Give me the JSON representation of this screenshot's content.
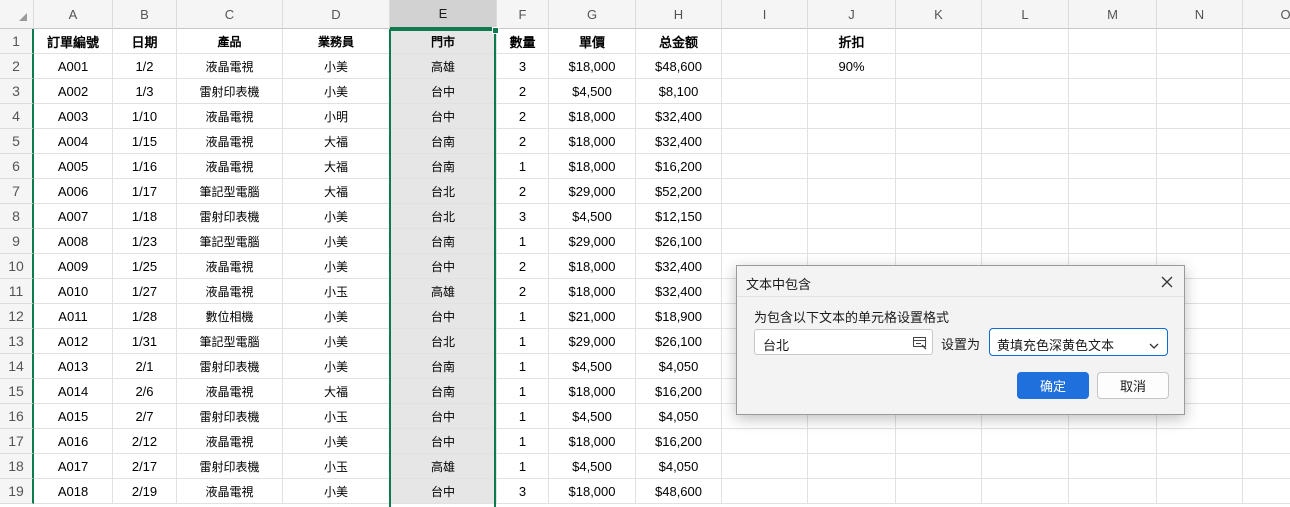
{
  "columns": [
    "A",
    "B",
    "C",
    "D",
    "E",
    "F",
    "G",
    "H",
    "I",
    "J",
    "K",
    "L",
    "M",
    "N",
    "O"
  ],
  "selected_column": "E",
  "row_numbers": [
    "1",
    "2",
    "3",
    "4",
    "5",
    "6",
    "7",
    "8",
    "9",
    "10",
    "11",
    "12",
    "13",
    "14",
    "15",
    "16",
    "17",
    "18",
    "19"
  ],
  "rows": [
    [
      "訂單編號",
      "日期",
      "產品",
      "業務員",
      "門市",
      "數量",
      "單價",
      "总金额",
      "",
      "折扣",
      "",
      "",
      "",
      "",
      ""
    ],
    [
      "A001",
      "1/2",
      "液晶電視",
      "小美",
      "高雄",
      "3",
      "$18,000",
      "$48,600",
      "",
      "90%",
      "",
      "",
      "",
      "",
      ""
    ],
    [
      "A002",
      "1/3",
      "雷射印表機",
      "小美",
      "台中",
      "2",
      "$4,500",
      "$8,100",
      "",
      "",
      "",
      "",
      "",
      "",
      ""
    ],
    [
      "A003",
      "1/10",
      "液晶電視",
      "小明",
      "台中",
      "2",
      "$18,000",
      "$32,400",
      "",
      "",
      "",
      "",
      "",
      "",
      ""
    ],
    [
      "A004",
      "1/15",
      "液晶電視",
      "大福",
      "台南",
      "2",
      "$18,000",
      "$32,400",
      "",
      "",
      "",
      "",
      "",
      "",
      ""
    ],
    [
      "A005",
      "1/16",
      "液晶電視",
      "大福",
      "台南",
      "1",
      "$18,000",
      "$16,200",
      "",
      "",
      "",
      "",
      "",
      "",
      ""
    ],
    [
      "A006",
      "1/17",
      "筆記型電腦",
      "大福",
      "台北",
      "2",
      "$29,000",
      "$52,200",
      "",
      "",
      "",
      "",
      "",
      "",
      ""
    ],
    [
      "A007",
      "1/18",
      "雷射印表機",
      "小美",
      "台北",
      "3",
      "$4,500",
      "$12,150",
      "",
      "",
      "",
      "",
      "",
      "",
      ""
    ],
    [
      "A008",
      "1/23",
      "筆記型電腦",
      "小美",
      "台南",
      "1",
      "$29,000",
      "$26,100",
      "",
      "",
      "",
      "",
      "",
      "",
      ""
    ],
    [
      "A009",
      "1/25",
      "液晶電視",
      "小美",
      "台中",
      "2",
      "$18,000",
      "$32,400",
      "",
      "",
      "",
      "",
      "",
      "",
      ""
    ],
    [
      "A010",
      "1/27",
      "液晶電視",
      "小玉",
      "高雄",
      "2",
      "$18,000",
      "$32,400",
      "",
      "",
      "",
      "",
      "",
      "",
      ""
    ],
    [
      "A011",
      "1/28",
      "數位相機",
      "小美",
      "台中",
      "1",
      "$21,000",
      "$18,900",
      "",
      "",
      "",
      "",
      "",
      "",
      ""
    ],
    [
      "A012",
      "1/31",
      "筆記型電腦",
      "小美",
      "台北",
      "1",
      "$29,000",
      "$26,100",
      "",
      "",
      "",
      "",
      "",
      "",
      ""
    ],
    [
      "A013",
      "2/1",
      "雷射印表機",
      "小美",
      "台南",
      "1",
      "$4,500",
      "$4,050",
      "",
      "",
      "",
      "",
      "",
      "",
      ""
    ],
    [
      "A014",
      "2/6",
      "液晶電視",
      "大福",
      "台南",
      "1",
      "$18,000",
      "$16,200",
      "",
      "",
      "",
      "",
      "",
      "",
      ""
    ],
    [
      "A015",
      "2/7",
      "雷射印表機",
      "小玉",
      "台中",
      "1",
      "$4,500",
      "$4,050",
      "",
      "",
      "",
      "",
      "",
      "",
      ""
    ],
    [
      "A016",
      "2/12",
      "液晶電視",
      "小美",
      "台中",
      "1",
      "$18,000",
      "$16,200",
      "",
      "",
      "",
      "",
      "",
      "",
      ""
    ],
    [
      "A017",
      "2/17",
      "雷射印表機",
      "小玉",
      "高雄",
      "1",
      "$4,500",
      "$4,050",
      "",
      "",
      "",
      "",
      "",
      "",
      ""
    ],
    [
      "A018",
      "2/19",
      "液晶電視",
      "小美",
      "台中",
      "3",
      "$18,000",
      "$48,600",
      "",
      "",
      "",
      "",
      "",
      "",
      ""
    ]
  ],
  "dialog": {
    "title": "文本中包含",
    "prompt": "为包含以下文本的单元格设置格式",
    "input_value": "台北",
    "set_as_label": "设置为",
    "format_option": "黄填充色深黄色文本",
    "ok_label": "确定",
    "cancel_label": "取消"
  },
  "colors": {
    "selection": "#0e7a4e",
    "selected_column_fill": "#e6e6e6",
    "ok_button": "#1f6fdc"
  }
}
